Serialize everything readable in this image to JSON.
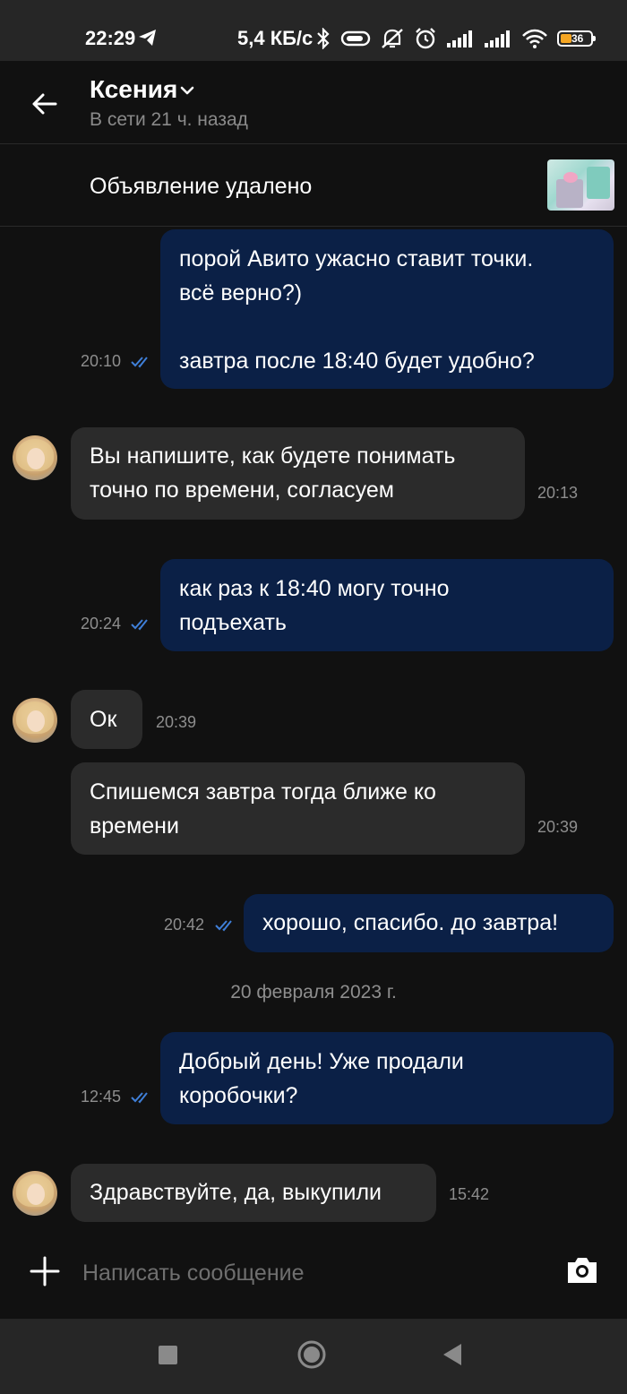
{
  "status_bar": {
    "time": "22:29",
    "network_speed": "5,4 КБ/с",
    "battery_level": "36",
    "icons": [
      "telegram-icon",
      "bluetooth-icon",
      "vpn-icon",
      "mute-icon",
      "alarm-icon",
      "signal-icon",
      "signal-icon",
      "wifi-icon",
      "battery-icon"
    ],
    "battery_color": "#f5a623"
  },
  "header": {
    "contact_name": "Ксения",
    "status": "В сети 21 ч. назад"
  },
  "listing": {
    "title": "Объявление удалено"
  },
  "messages": [
    {
      "direction": "out",
      "lines": [
        "порой Авито ужасно ставит точки.",
        "всё верно?)",
        "",
        "завтра после 18:40 будет удобно?"
      ],
      "time": "20:10",
      "read": true
    },
    {
      "direction": "in",
      "lines": [
        "Вы напишите, как будете понимать",
        "точно по времени, согласуем"
      ],
      "time": "20:13",
      "avatar": true
    },
    {
      "direction": "out",
      "lines": [
        "как раз к 18:40 могу точно",
        "подъехать"
      ],
      "time": "20:24",
      "read": true
    },
    {
      "direction": "in",
      "lines": [
        "Ок"
      ],
      "time": "20:39",
      "avatar": true
    },
    {
      "direction": "in",
      "lines": [
        "Спишемся завтра тогда ближе ко",
        "времени"
      ],
      "time": "20:39",
      "avatar": false
    },
    {
      "direction": "out",
      "lines": [
        "хорошо, спасибо. до завтра!"
      ],
      "time": "20:42",
      "read": true
    },
    {
      "direction": "out",
      "lines": [
        "Добрый день! Уже продали",
        "коробочки?"
      ],
      "time": "12:45",
      "read": true
    },
    {
      "direction": "in",
      "lines": [
        "Здравствуйте, да, выкупили"
      ],
      "time": "15:42",
      "avatar": true
    }
  ],
  "date_separator": "20 февраля 2023 г.",
  "composer": {
    "placeholder": "Написать сообщение"
  },
  "colors": {
    "background": "#111111",
    "outgoing_bubble": "#0b2046",
    "incoming_bubble": "#2b2b2b",
    "read_ticks": "#3f7fd8",
    "muted_text": "#8e8e8e"
  }
}
